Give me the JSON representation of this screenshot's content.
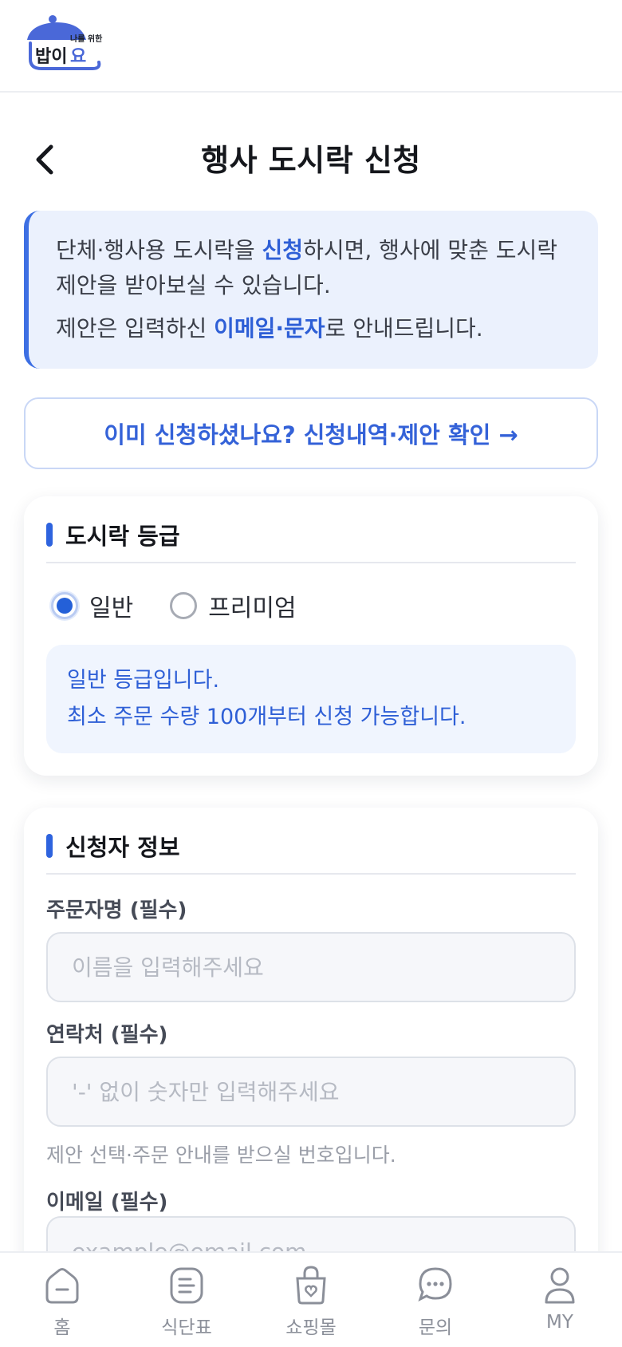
{
  "header": {
    "logo_small_text": "나를 위한",
    "logo_text": "밥이요"
  },
  "title": {
    "text": "행사 도시락 신청"
  },
  "notice": {
    "line1_pre": "단체·행사용 도시락을 ",
    "line1_bold": "신청",
    "line1_post": "하시면, 행사에 맞춘 도시락 제안을 받아보실 수 있습니다.",
    "line2_pre": "제안은 입력하신 ",
    "line2_bold": "이메일·문자",
    "line2_post": "로 안내드립니다."
  },
  "history_link": {
    "label": "이미 신청하셨나요? 신청내역·제안 확인 →"
  },
  "grade_section": {
    "title": "도시락 등급",
    "options": [
      {
        "label": "일반",
        "selected": true
      },
      {
        "label": "프리미엄",
        "selected": false
      }
    ],
    "info_line1": "일반 등급입니다.",
    "info_line2": "최소 주문 수량 100개부터 신청 가능합니다."
  },
  "applicant_section": {
    "title": "신청자 정보",
    "name": {
      "label": "주문자명 (필수)",
      "placeholder": "이름을 입력해주세요",
      "value": ""
    },
    "phone": {
      "label": "연락처 (필수)",
      "placeholder": "'-' 없이 숫자만 입력해주세요",
      "value": "",
      "help": "제안 선택·주문 안내를 받으실 번호입니다."
    },
    "email": {
      "label": "이메일 (필수)",
      "placeholder": "example@email.com",
      "value": ""
    }
  },
  "bottom_nav": {
    "items": [
      {
        "label": "홈",
        "icon": "home-icon"
      },
      {
        "label": "식단표",
        "icon": "menu-list-icon"
      },
      {
        "label": "쇼핑몰",
        "icon": "shopping-bag-icon"
      },
      {
        "label": "문의",
        "icon": "chat-icon"
      },
      {
        "label": "MY",
        "icon": "profile-icon"
      }
    ]
  },
  "colors": {
    "accent": "#2e63de",
    "notice_bg": "#ebf1fd",
    "label_text": "#464b57",
    "nav_inactive": "#8b8f99"
  }
}
